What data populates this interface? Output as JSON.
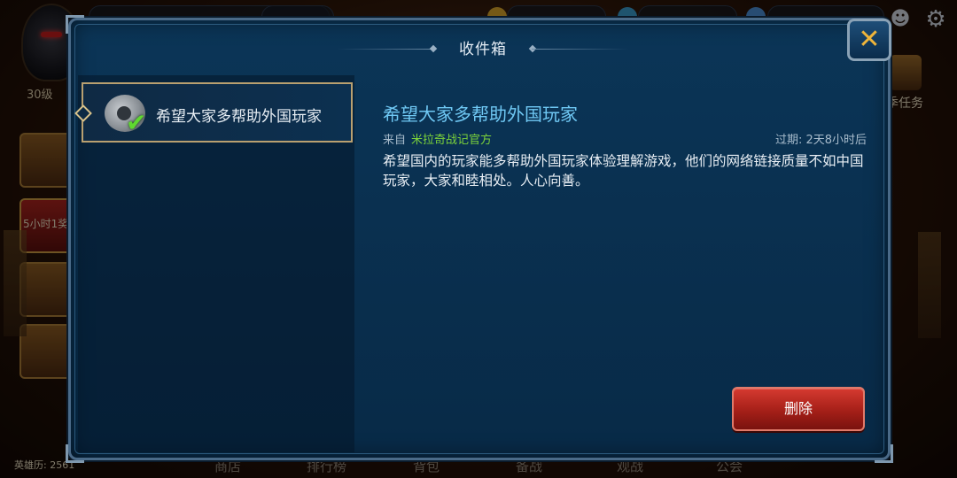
{
  "background": {
    "level_label": "30级",
    "side_text": "5小时1奖",
    "hero_power": "英雄历: 2561",
    "right_task": "季任务",
    "bottom_tabs": [
      "商店",
      "排行榜",
      "背包",
      "备战",
      "观战",
      "公会"
    ]
  },
  "dialog": {
    "title": "收件箱",
    "close_icon": "close-icon",
    "mail_list": [
      {
        "title": "希望大家多帮助外国玩家",
        "status": "read",
        "icon": "mail-disc-icon"
      }
    ],
    "selected_mail": {
      "title": "希望大家多帮助外国玩家",
      "from_label": "来自",
      "sender": "米拉奇战记官方",
      "expiry": "过期: 2天8小时后",
      "body": "希望国内的玩家能多帮助外国玩家体验理解游戏，他们的网络链接质量不如中国玩家，大家和睦相处。人心向善。"
    },
    "delete_label": "删除"
  },
  "colors": {
    "dialog_bg": "#0b3557",
    "title_accent": "#6fc8f4",
    "sender_green": "#7cd33a",
    "delete_red": "#c22a22",
    "close_x": "#f0b53a"
  }
}
